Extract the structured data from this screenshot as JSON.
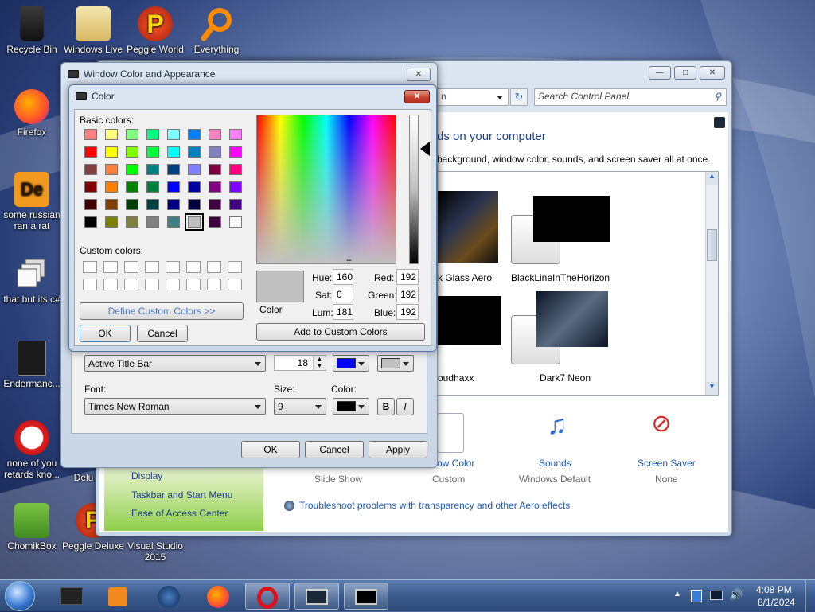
{
  "desktop": {
    "icons": [
      {
        "label": "Recycle Bin"
      },
      {
        "label": "Windows Live"
      },
      {
        "label": "Peggle World"
      },
      {
        "label": "Everything"
      },
      {
        "label": "Firefox"
      },
      {
        "label": "some russian ran a rat"
      },
      {
        "label": "that but its c#"
      },
      {
        "label": "Endermanc..."
      },
      {
        "label": "none of you retards kno..."
      },
      {
        "label": "ChomikBox"
      },
      {
        "label": "Peggle Deluxe"
      },
      {
        "label": "Visual Studio 2015"
      },
      {
        "label": "Delu"
      }
    ]
  },
  "control_panel": {
    "search_placeholder": "Search Control Panel",
    "address_text": "n",
    "heading": "ds on your computer",
    "subheading": "background, window color, sounds, and screen saver all at once.",
    "themes": [
      {
        "name": "k Glass Aero"
      },
      {
        "name": "BlackLineInTheHorizon"
      },
      {
        "name": "oudhaxx"
      },
      {
        "name": "Dark7 Neon"
      }
    ],
    "bottom_items": [
      {
        "label": "ow Color",
        "sub": "Custom"
      },
      {
        "label": "Sounds",
        "sub": "Windows Default"
      },
      {
        "label": "Screen Saver",
        "sub": "None"
      }
    ],
    "slide_show": "Slide Show",
    "left_links": [
      "Display",
      "Taskbar and Start Menu",
      "Ease of Access Center"
    ],
    "troubleshoot": "Troubleshoot problems with transparency and other Aero effects"
  },
  "appearance": {
    "title": "Window Color and Appearance",
    "item_value": "Active Title Bar",
    "size_value": "18",
    "font_label": "Font:",
    "font_value": "Times New Roman",
    "size_label": "Size:",
    "font_size_value": "9",
    "color_label": "Color:",
    "bold_label": "B",
    "italic_label": "I",
    "ok": "OK",
    "cancel": "Cancel",
    "apply": "Apply",
    "colors": {
      "item_color1": "#0000ff",
      "item_color2": "#c0c0c0",
      "font_color": "#000000"
    }
  },
  "color_dialog": {
    "title": "Color",
    "basic_colors_label": "Basic colors:",
    "custom_colors_label": "Custom colors:",
    "define_custom": "Define Custom Colors >>",
    "ok": "OK",
    "cancel": "Cancel",
    "add_custom": "Add to Custom Colors",
    "color_label": "Color",
    "hue_label": "Hue:",
    "hue": "160",
    "sat_label": "Sat:",
    "sat": "0",
    "lum_label": "Lum:",
    "lum": "181",
    "red_label": "Red:",
    "red": "192",
    "green_label": "Green:",
    "green": "192",
    "blue_label": "Blue:",
    "blue": "192",
    "basic_colors": [
      "#ff8080",
      "#ffff80",
      "#80ff80",
      "#00ff80",
      "#80ffff",
      "#0080ff",
      "#ff80c0",
      "#ff80ff",
      "#ff0000",
      "#ffff00",
      "#80ff00",
      "#00ff40",
      "#00ffff",
      "#0080c0",
      "#8080c0",
      "#ff00ff",
      "#804040",
      "#ff8040",
      "#00ff00",
      "#008080",
      "#004080",
      "#8080ff",
      "#800040",
      "#ff0080",
      "#800000",
      "#ff8000",
      "#008000",
      "#008040",
      "#0000ff",
      "#0000a0",
      "#800080",
      "#8000ff",
      "#400000",
      "#804000",
      "#004000",
      "#004040",
      "#000080",
      "#000040",
      "#400040",
      "#400080",
      "#000000",
      "#808000",
      "#808040",
      "#808080",
      "#408080",
      "#c0c0c0",
      "#400040",
      "#ffffff"
    ],
    "selected_color": "#c0c0c0"
  },
  "taskbar": {
    "time": "4:08 PM",
    "date": "8/1/2024"
  }
}
